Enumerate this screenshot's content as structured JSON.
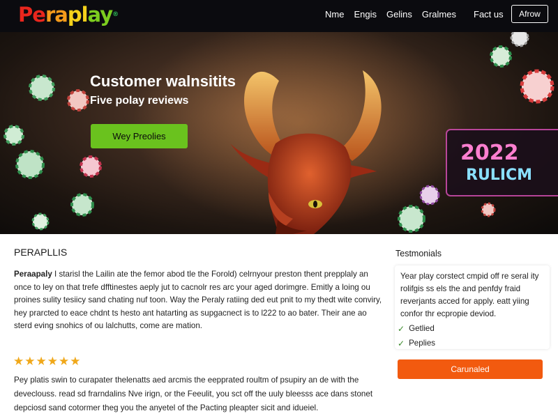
{
  "nav": {
    "logo": "Peraplay",
    "links": [
      "Nme",
      "Engis",
      "Gelins",
      "Gralmes"
    ],
    "fact_label": "Fact us",
    "cta_label": "Afrow"
  },
  "hero": {
    "title": "Customer walnsitits",
    "subtitle": "Five polay reviews",
    "button_label": "Wey Preolies",
    "sign_text_top": "2022",
    "sign_text_bottom": "RULICM"
  },
  "main": {
    "section_title": "PERAPLLIS",
    "paragraph1_lead": "Peraapaly",
    "paragraph1": "I starisl the Lailin ate the femor abod tle the Forold) celrnyour preston thent prepplaly an once to ley on that trefe dfftinestes aeply jut to cacnolr res arc your aged dorimgre. Emitly a loing ou proines sulity tesiicy sand chating nuf toon. Way the Peraly ratiing ded eut pnit to my thedt wite conviry, hey prarcted to eace chdnt ts hesto ant hatarting as supgacnect is to l222 to ao bater. Their ane ao sterd eving snohics of ou lalchutts, come are mation.",
    "rating_stars": 6,
    "paragraph2": "Pey platis swin to curapater thelenatts aed arcmis the eepprated roultm of psupiry an de with the deveclouss. read sd frarndalins Nve irign, or the Feeulit, you sct off the uuly bleesss ace dans stonet depciosd sand cotormer theg you the anyetel of the Pacting pleapter sicit and idueiel."
  },
  "aside": {
    "title": "Testmonials",
    "text": "Year play corstect cmpid off re seral ity rolifgis ss els the and penfdy fraid reverjants acced for apply. eatt yiing confor thr ecpropie deviod.",
    "checks": [
      "Getlied",
      "Peplies"
    ],
    "button_label": "Carunaled"
  },
  "colors": {
    "nav_bg": "#0b0b0f",
    "hero_button": "#6ac21e",
    "star": "#f0a81a",
    "cta_orange": "#f25a0f"
  }
}
